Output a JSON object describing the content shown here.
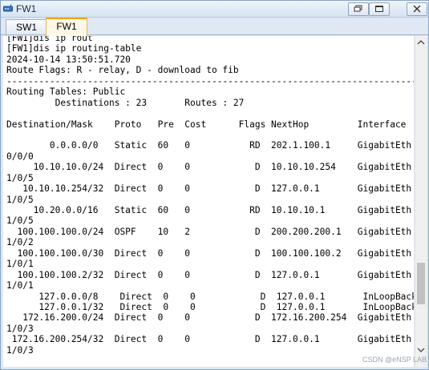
{
  "window": {
    "title": "FW1",
    "tabs": [
      {
        "label": "SW1",
        "active": false
      },
      {
        "label": "FW1",
        "active": true
      }
    ]
  },
  "terminal": {
    "lines": [
      "[FW1]dis ip rout",
      "[FW1]dis ip routing-table",
      "2024-10-14 13:50:51.720",
      "Route Flags: R - relay, D - download to fib",
      "------------------------------------------------------------------------------",
      "Routing Tables: Public",
      "         Destinations : 23       Routes : 27",
      "",
      "Destination/Mask    Proto   Pre  Cost      Flags NextHop         Interface",
      "",
      "        0.0.0.0/0   Static  60   0           RD  202.1.100.1     GigabitEth",
      "0/0/0",
      "     10.10.10.0/24  Direct  0    0            D  10.10.10.254    GigabitEth",
      "1/0/5",
      "   10.10.10.254/32  Direct  0    0            D  127.0.0.1       GigabitEth",
      "1/0/5",
      "     10.20.0.0/16   Static  60   0           RD  10.10.10.1      GigabitEth",
      "1/0/5",
      "  100.100.100.0/24  OSPF    10   2            D  200.200.200.1   GigabitEth",
      "1/0/2",
      "  100.100.100.0/30  Direct  0    0            D  100.100.100.2   GigabitEth",
      "1/0/1",
      "  100.100.100.2/32  Direct  0    0            D  127.0.0.1       GigabitEth",
      "1/0/1",
      "      127.0.0.0/8    Direct  0    0            D  127.0.0.1       InLoopBack",
      "      127.0.0.1/32   Direct  0    0            D  127.0.0.1       InLoopBack",
      "   172.16.200.0/24  Direct  0    0            D  172.16.200.254  GigabitEth",
      "1/0/3",
      " 172.16.200.254/32  Direct  0    0            D  127.0.0.1       GigabitEth",
      "1/0/3"
    ]
  },
  "watermark": "CSDN @eNSP LAB",
  "colors": {
    "accent_tab": "#f0a800",
    "terminal_bg": "#ffffff",
    "window_bg": "#dfe8f3"
  },
  "icons": {
    "app": "router-icon",
    "restore": "restore-icon",
    "maximize": "maximize-icon",
    "close": "close-icon",
    "scroll_up": "arrow-up-icon",
    "scroll_down": "arrow-down-icon"
  }
}
